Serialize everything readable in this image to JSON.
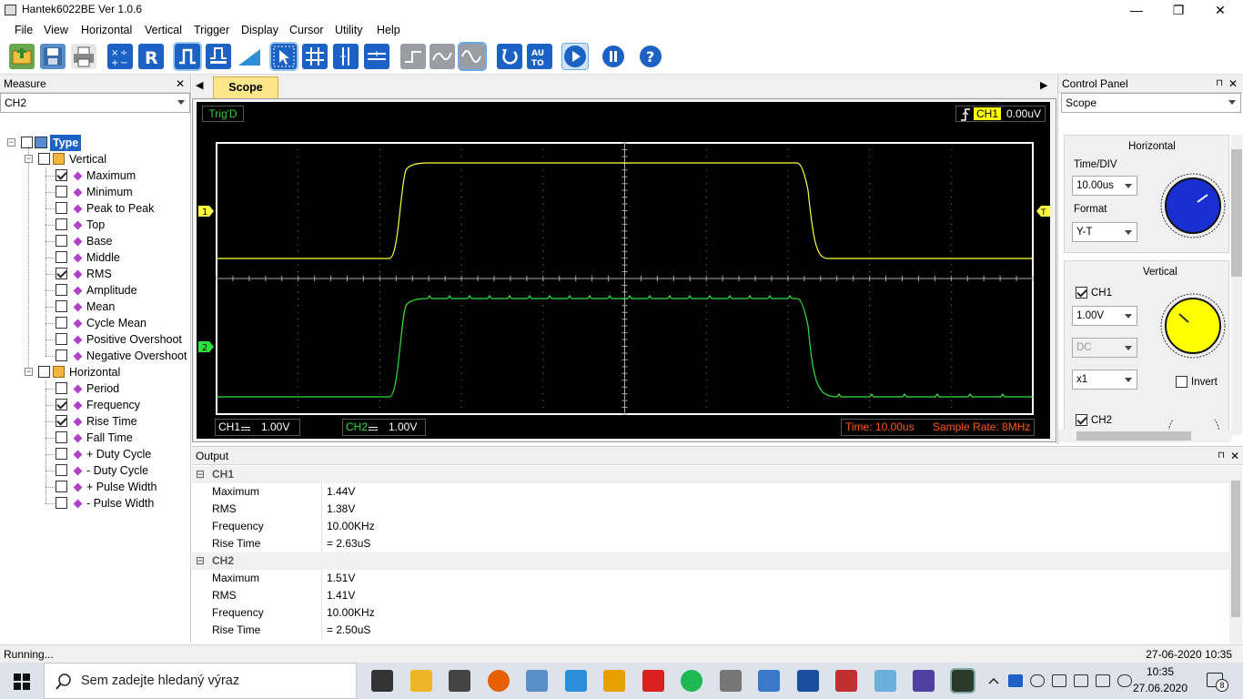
{
  "window": {
    "title": "Hantek6022BE Ver 1.0.6",
    "controls": {
      "minimize": "—",
      "restore": "❐",
      "close": "✕"
    }
  },
  "menu": [
    "File",
    "View",
    "Horizontal",
    "Vertical",
    "Trigger",
    "Display",
    "Cursor",
    "Utility",
    "Help"
  ],
  "toolbar": {
    "icons": [
      "open-file-icon",
      "save-icon",
      "print-icon",
      "math-icon",
      "reference-icon",
      "auto-trigger-icon",
      "normal-trigger-icon",
      "ramp-icon",
      "cursor-select-icon",
      "grid-icon",
      "vertical-cursor-icon",
      "horizontal-cursor-icon",
      "step-icon",
      "wave-icon",
      "sine-icon",
      "undo-icon",
      "auto-set-icon",
      "run-icon",
      "pause-icon",
      "help-icon"
    ],
    "auto_label": "AU TO"
  },
  "measure": {
    "title": "Measure",
    "close": "✕",
    "channel": "CH2",
    "root_label": "Type",
    "vertical_label": "Vertical",
    "horizontal_label": "Horizontal",
    "vertical_items": [
      {
        "label": "Maximum",
        "checked": true
      },
      {
        "label": "Minimum",
        "checked": false
      },
      {
        "label": "Peak to Peak",
        "checked": false
      },
      {
        "label": "Top",
        "checked": false
      },
      {
        "label": "Base",
        "checked": false
      },
      {
        "label": "Middle",
        "checked": false
      },
      {
        "label": "RMS",
        "checked": true
      },
      {
        "label": "Amplitude",
        "checked": false
      },
      {
        "label": "Mean",
        "checked": false
      },
      {
        "label": "Cycle Mean",
        "checked": false
      },
      {
        "label": "Positive Overshoot",
        "checked": false
      },
      {
        "label": "Negative Overshoot",
        "checked": false
      }
    ],
    "horizontal_items": [
      {
        "label": "Period",
        "checked": false
      },
      {
        "label": "Frequency",
        "checked": true
      },
      {
        "label": "Rise Time",
        "checked": true
      },
      {
        "label": "Fall Time",
        "checked": false
      },
      {
        "label": "+ Duty Cycle",
        "checked": false
      },
      {
        "label": "- Duty Cycle",
        "checked": false
      },
      {
        "label": "+ Pulse Width",
        "checked": false
      },
      {
        "label": "- Pulse Width",
        "checked": false
      }
    ]
  },
  "scope": {
    "tab_label": "Scope",
    "trig_status": "Trig'D",
    "trig_channel": "CH1",
    "trig_value": "0.00uV",
    "ch1_marker": "1",
    "ch2_marker": "2",
    "trig_marker": "T",
    "ch1_info_label": "CH1",
    "ch1_info_value": "1.00V",
    "ch2_info_label": "CH2",
    "ch2_info_value": "1.00V",
    "time_info": "Time: 10.00us",
    "sample_rate": "Sample Rate: 8MHz",
    "colors": {
      "ch1": "#ffff40",
      "ch2": "#2ee03a",
      "accent": "#ff5a14"
    }
  },
  "control_panel": {
    "title": "Control Panel",
    "pin": "⊓",
    "close": "✕",
    "mode": "Scope",
    "horizontal_title": "Horizontal",
    "timediv_label": "Time/DIV",
    "timediv_value": "10.00us",
    "format_label": "Format",
    "format_value": "Y-T",
    "vertical_title": "Vertical",
    "ch1_label": "CH1",
    "ch1_checked": true,
    "ch1_volt": "1.00V",
    "ch1_coupling": "DC",
    "ch1_probe": "x1",
    "invert_label": "Invert",
    "ch2_label": "CH2",
    "ch2_checked": true
  },
  "output": {
    "title": "Output",
    "groups": [
      {
        "name": "CH1",
        "rows": [
          {
            "k": "Maximum",
            "v": "1.44V"
          },
          {
            "k": "RMS",
            "v": "1.38V"
          },
          {
            "k": "Frequency",
            "v": "10.00KHz"
          },
          {
            "k": "Rise Time",
            "v": "= 2.63uS"
          }
        ]
      },
      {
        "name": "CH2",
        "rows": [
          {
            "k": "Maximum",
            "v": "1.51V"
          },
          {
            "k": "RMS",
            "v": "1.41V"
          },
          {
            "k": "Frequency",
            "v": "10.00KHz"
          },
          {
            "k": "Rise Time",
            "v": "= 2.50uS"
          }
        ]
      }
    ]
  },
  "statusbar": {
    "left": "Running...",
    "right": "27-06-2020  10:35"
  },
  "taskbar": {
    "search_placeholder": "Sem zadejte hledaný výraz",
    "apps": [
      "task-view-icon",
      "file-explorer-icon",
      "store-icon",
      "firefox-icon",
      "network-drive-icon",
      "phone-icon",
      "pen-icon",
      "wifi-tool-icon",
      "spotify-icon",
      "printer-app-icon",
      "remote-desktop-icon",
      "floppy-icon",
      "puzzle-icon",
      "paper-icon",
      "pencil-app-icon",
      "oscilloscope-app-icon"
    ],
    "tray": [
      "chevron-up-icon",
      "fs-icon",
      "cloud-icon",
      "usb-icon",
      "monitor-icon",
      "volume-mute-icon",
      "onedrive-icon"
    ],
    "time": "10:35",
    "date": "27.06.2020",
    "notifications": "8"
  }
}
